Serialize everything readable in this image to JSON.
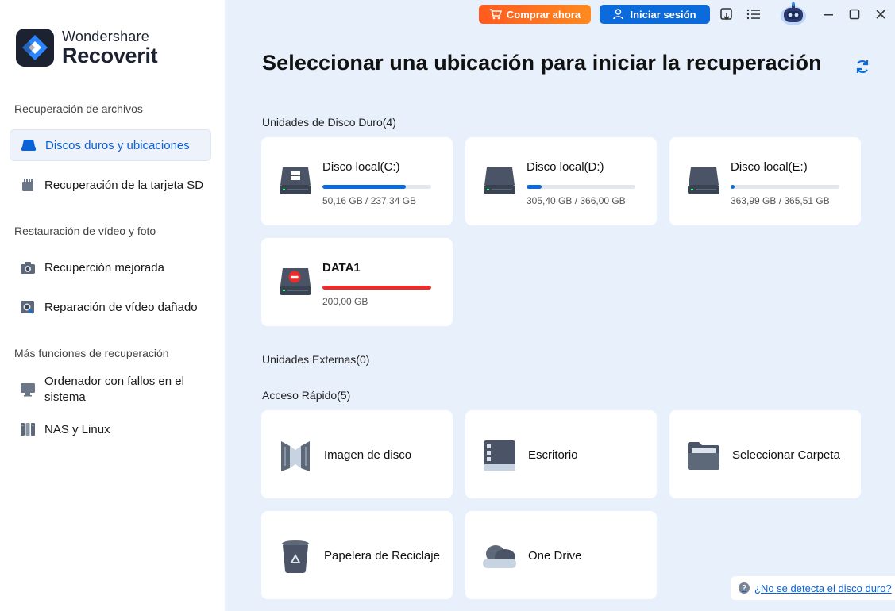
{
  "brand": {
    "top": "Wondershare",
    "bottom": "Recoverit"
  },
  "sidebar": {
    "sections": [
      {
        "title": "Recuperación de archivos"
      },
      {
        "title": "Restauración de vídeo y foto"
      },
      {
        "title": "Más funciones de recuperación"
      }
    ],
    "items": [
      {
        "label": "Discos duros y ubicaciones",
        "icon": "hard-drive-icon",
        "active": true
      },
      {
        "label": "Recuperación de la tarjeta SD",
        "icon": "sd-card-icon"
      },
      {
        "label": "Recuperción mejorada",
        "icon": "camera-icon"
      },
      {
        "label": "Reparación de vídeo dañado",
        "icon": "video-repair-icon"
      },
      {
        "label": "Ordenador con fallos en el sistema",
        "icon": "monitor-icon"
      },
      {
        "label": "NAS y Linux",
        "icon": "nas-icon"
      }
    ]
  },
  "topbar": {
    "buy_label": "Comprar ahora",
    "login_label": "Iniciar sesión",
    "accent_buy": "#ff6a1f",
    "accent_login": "#0b6bdc"
  },
  "main": {
    "title": "Seleccionar una ubicación para iniciar la recuperación",
    "hard_drives_label": "Unidades de Disco Duro(4)",
    "external_label": "Unidades Externas(0)",
    "quick_label": "Acceso Rápido(5)",
    "drives": [
      {
        "name": "Disco local(C:)",
        "size": "50,16 GB / 237,34 GB",
        "used_fraction": 0.77,
        "icon": "windows-drive-icon"
      },
      {
        "name": "Disco local(D:)",
        "size": "305,40 GB / 366,00 GB",
        "used_fraction": 0.14,
        "icon": "drive-icon"
      },
      {
        "name": "Disco local(E:)",
        "size": "363,99 GB / 365,51 GB",
        "used_fraction": 0.04,
        "icon": "drive-icon"
      },
      {
        "name": "DATA1",
        "size": "200,00 GB",
        "used_fraction": 1.0,
        "icon": "drive-error-icon",
        "status_color": "#ee2b2b"
      }
    ],
    "quick_access": [
      {
        "name": "Imagen de disco",
        "icon": "disk-image-icon"
      },
      {
        "name": "Escritorio",
        "icon": "desktop-icon"
      },
      {
        "name": "Seleccionar Carpeta",
        "icon": "folder-icon"
      },
      {
        "name": "Papelera de Reciclaje",
        "icon": "recycle-bin-icon"
      },
      {
        "name": "One Drive",
        "icon": "cloud-icon"
      }
    ],
    "help_link": "¿No se detecta el disco duro?",
    "help_badge": "?"
  }
}
